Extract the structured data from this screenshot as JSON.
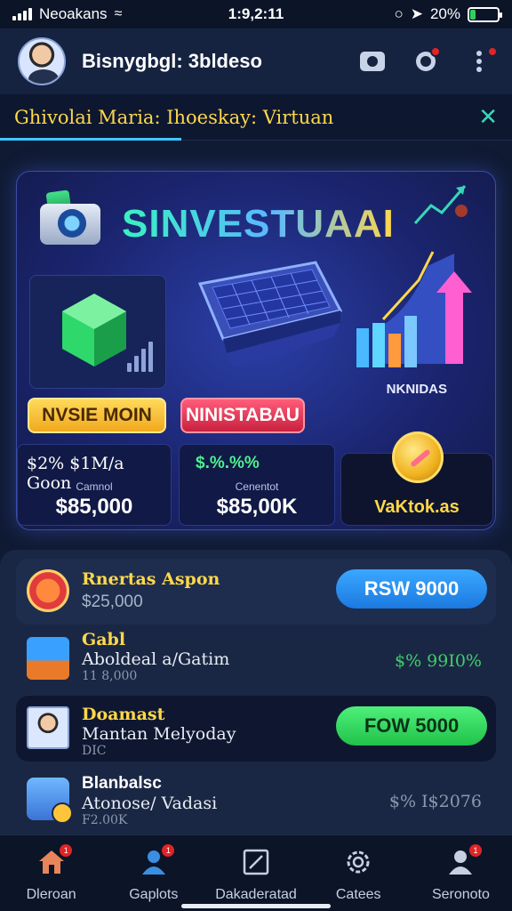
{
  "status_bar": {
    "carrier": "Neoakans",
    "time": "1:9,2:11",
    "battery": "20%",
    "battery_level": 0.2
  },
  "header": {
    "title": "Bisnygbgl: 3bldeso"
  },
  "ticker": {
    "text": "Ghivolai Maria: Ihoeskay: Virtuan"
  },
  "hero": {
    "brand": "SINVESTUAAI",
    "chart_label": "NKNIDAS",
    "invest_button": "NVSIE MOIN",
    "stake_button": "NINISTABAU",
    "stat_1": {
      "top": "$2% $1M/a Goon",
      "sub": "Camnol",
      "value": "$85,000"
    },
    "stat_2": {
      "top": "$.%.%%",
      "sub": "Cenentot",
      "value": "$85,00K"
    },
    "wallet_label": "VaKtok.as"
  },
  "list": [
    {
      "title": "Rnertas Aspon",
      "subtitle": "$25,000",
      "button": "RSW 9000"
    },
    {
      "title": "Gabl",
      "subtitle": "Aboldeal a/Gatim",
      "detail": "11 8,000",
      "amount": "$% 99I0%"
    },
    {
      "title": "Doamast",
      "subtitle": "Mantan Melyoday",
      "detail": "DIC",
      "button": "FOW 5000"
    },
    {
      "title": "Blanbalsc",
      "subtitle": "Atonose/ Vadasi",
      "detail": "F2.00K",
      "amount": "$% I$2076"
    }
  ],
  "bottom_nav": [
    {
      "label": "Dleroan",
      "icon": "home-icon",
      "badge": "1"
    },
    {
      "label": "Gaplots",
      "icon": "user-icon",
      "badge": "1"
    },
    {
      "label": "Dakaderatad",
      "icon": "edit-icon"
    },
    {
      "label": "Catees",
      "icon": "settings-icon"
    },
    {
      "label": "Seronoto",
      "icon": "profile-icon",
      "badge": "1"
    }
  ],
  "colors": {
    "accent_yellow": "#ffd84a",
    "accent_green": "#4ef07a",
    "accent_blue": "#3aa8ff",
    "background": "#101a33"
  }
}
